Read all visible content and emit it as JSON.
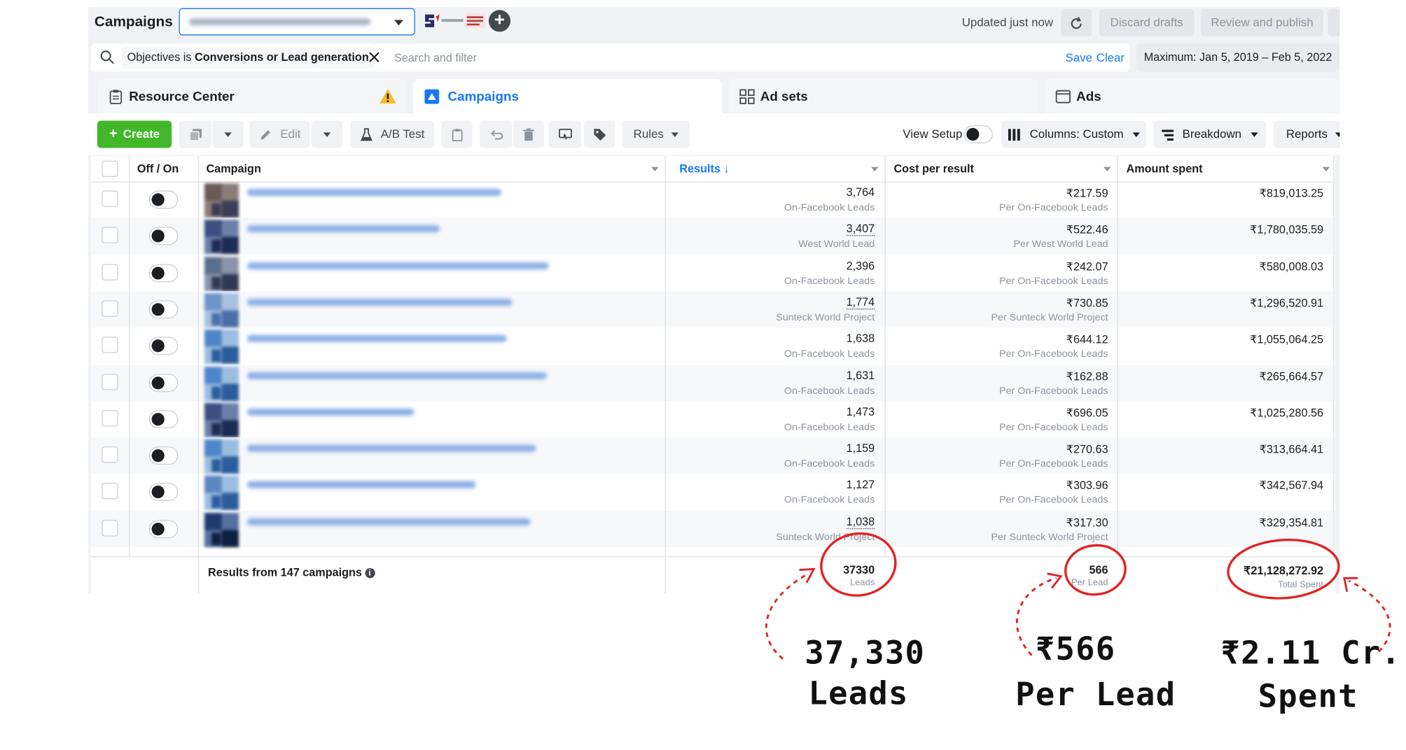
{
  "header": {
    "title": "Campaigns",
    "updated": "Updated just now",
    "discard_label": "Discard drafts",
    "review_label": "Review and publish"
  },
  "filter": {
    "chip_prefix": "Objectives is",
    "chip_value": "Conversions or Lead generation",
    "search_placeholder": "Search and filter",
    "save_label": "Save",
    "clear_label": "Clear",
    "date_range": "Maximum: Jan 5, 2019 – Feb 5, 2022"
  },
  "tabs": [
    {
      "label": "Resource Center"
    },
    {
      "label": "Campaigns"
    },
    {
      "label": "Ad sets"
    },
    {
      "label": "Ads"
    }
  ],
  "toolbar": {
    "create_label": "Create",
    "edit_label": "Edit",
    "ab_test_label": "A/B Test",
    "rules_label": "Rules",
    "view_setup_label": "View Setup",
    "columns_label": "Columns: Custom",
    "breakdown_label": "Breakdown",
    "reports_label": "Reports"
  },
  "table": {
    "columns": {
      "toggle": "Off / On",
      "campaign": "Campaign",
      "results": "Results ↓",
      "cost": "Cost per result",
      "amount": "Amount spent"
    },
    "rows": [
      {
        "results": "3,764",
        "results_sub": "On-Facebook Leads",
        "cost": "₹217.59",
        "cost_sub": "Per On-Facebook Leads",
        "amount": "₹819,013.25"
      },
      {
        "results": "3,407",
        "results_sub": "West World Lead",
        "cost": "₹522.46",
        "cost_sub": "Per West World Lead",
        "amount": "₹1,780,035.59"
      },
      {
        "results": "2,396",
        "results_sub": "On-Facebook Leads",
        "cost": "₹242.07",
        "cost_sub": "Per On-Facebook Leads",
        "amount": "₹580,008.03"
      },
      {
        "results": "1,774",
        "results_sub": "Sunteck World Project",
        "cost": "₹730.85",
        "cost_sub": "Per Sunteck World Project",
        "amount": "₹1,296,520.91"
      },
      {
        "results": "1,638",
        "results_sub": "On-Facebook Leads",
        "cost": "₹644.12",
        "cost_sub": "Per On-Facebook Leads",
        "amount": "₹1,055,064.25"
      },
      {
        "results": "1,631",
        "results_sub": "On-Facebook Leads",
        "cost": "₹162.88",
        "cost_sub": "Per On-Facebook Leads",
        "amount": "₹265,664.57"
      },
      {
        "results": "1,473",
        "results_sub": "On-Facebook Leads",
        "cost": "₹696.05",
        "cost_sub": "Per On-Facebook Leads",
        "amount": "₹1,025,280.56"
      },
      {
        "results": "1,159",
        "results_sub": "On-Facebook Leads",
        "cost": "₹270.63",
        "cost_sub": "Per On-Facebook Leads",
        "amount": "₹313,664.41"
      },
      {
        "results": "1,127",
        "results_sub": "On-Facebook Leads",
        "cost": "₹303.96",
        "cost_sub": "Per On-Facebook Leads",
        "amount": "₹342,567.94"
      },
      {
        "results": "1,038",
        "results_sub": "Sunteck World Project",
        "cost": "₹317.30",
        "cost_sub": "Per Sunteck World Project",
        "amount": "₹329,354.81"
      }
    ],
    "footer": {
      "label": "Results from 147 campaigns",
      "results_total": "37330",
      "results_total_sub": "Leads",
      "cost_total": "566",
      "cost_total_sub": "Per Lead",
      "amount_total": "₹21,128,272.92",
      "amount_total_sub": "Total Spent"
    }
  },
  "annotations": {
    "leads_value": "37,330",
    "leads_label": "Leads",
    "cpl_value": "₹566",
    "cpl_label": "Per Lead",
    "spent_value": "₹2.11 Cr.",
    "spent_label": "Spent",
    "circle_color": "#e02424"
  },
  "colors": {
    "accent": "#1877f2",
    "create": "#42b72a"
  }
}
